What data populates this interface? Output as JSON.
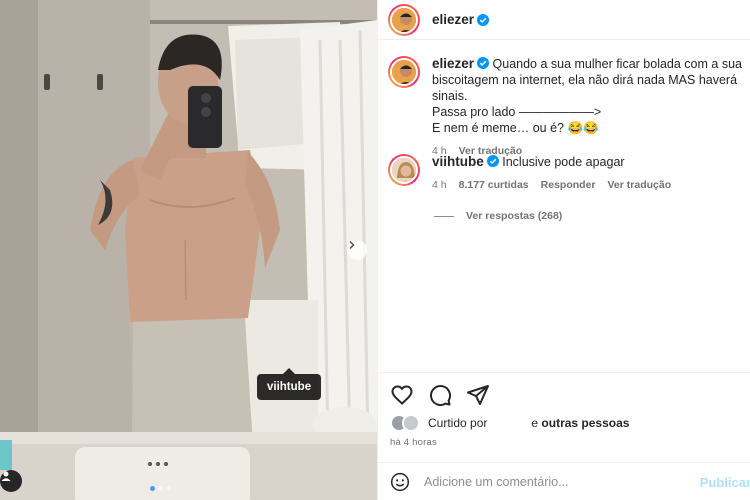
{
  "post": {
    "author": "eliezer",
    "image_tag": "viihtube"
  },
  "caption": {
    "username": "eliezer",
    "text_line1": "Quando a sua mulher ficar bolada com a sua",
    "text_line2": "biscoitagem na internet, ela não dirá nada MAS haverá sinais.",
    "text_line3": "Passa pro lado ——————>",
    "text_line4": "E nem é meme… ou é? 😂😂",
    "time": "4 h",
    "see_translation": "Ver tradução"
  },
  "comments": [
    {
      "username": "viihtube",
      "text": "Inclusive pode apagar",
      "time": "4 h",
      "likes": "8.177 curtidas",
      "reply_label": "Responder",
      "see_translation": "Ver tradução",
      "view_replies": "Ver respostas (268)"
    }
  ],
  "likes": {
    "prefix": "Curtido por",
    "suffix": "e",
    "others": "outras pessoas"
  },
  "time_ago": "há 4 horas",
  "add_comment": {
    "placeholder": "Adicione um comentário...",
    "post_label": "Publicar"
  },
  "icons": {
    "heart": "heart-icon",
    "comment": "comment-icon",
    "share": "share-icon",
    "emoji": "emoji-icon",
    "verified": "verified-icon",
    "next": "chevron-right-icon",
    "tag": "person-tag-icon"
  },
  "colors": {
    "verified": "#0095f6",
    "post_button": "#b2dffc",
    "carousel_active": "#3aa0ff"
  }
}
